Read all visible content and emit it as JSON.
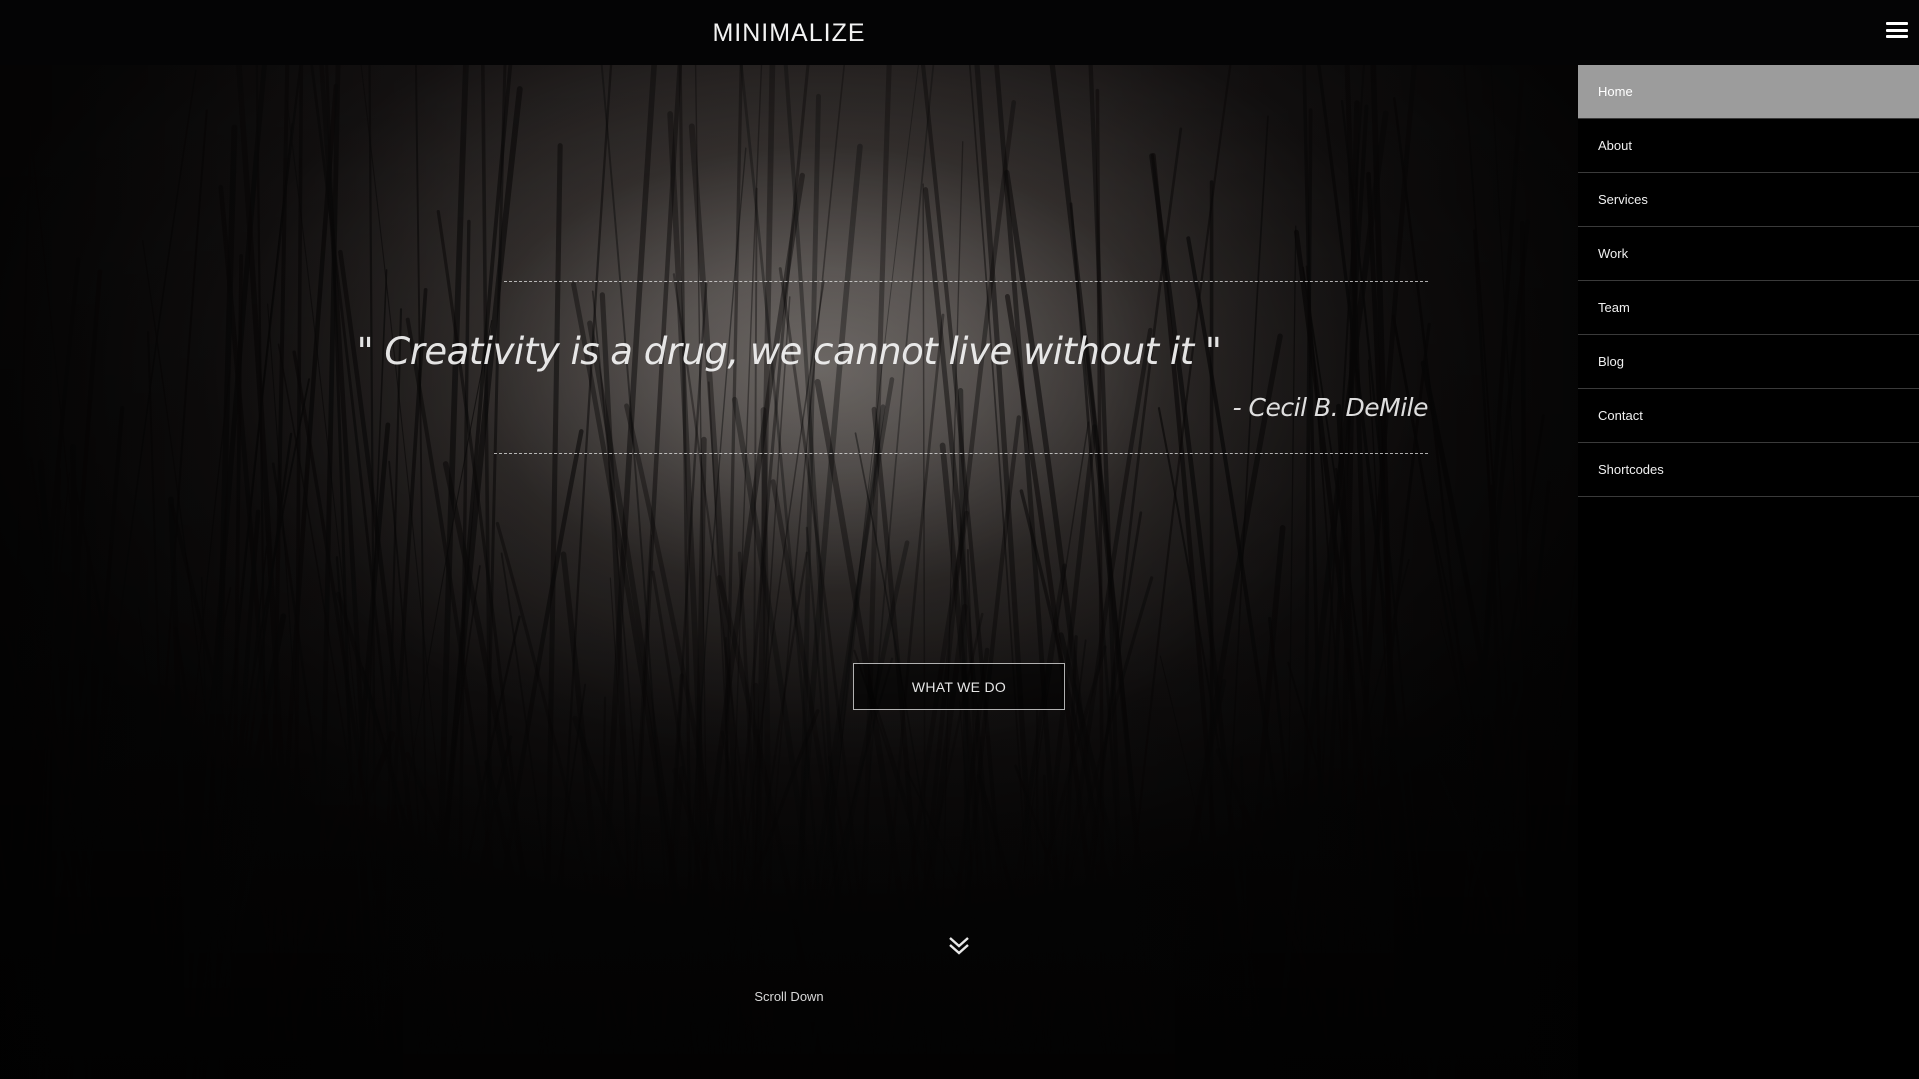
{
  "header": {
    "logo": "MINIMALIZE",
    "menu_icon": "hamburger-icon"
  },
  "hero": {
    "quote": "\" Creativity is a drug, we cannot live without it \"",
    "author": "- Cecil B. DeMile",
    "cta_label": "WHAT WE DO",
    "scroll_icon": "double-chevron-down-icon",
    "scroll_label": "Scroll Down"
  },
  "sidenav": {
    "items": [
      {
        "label": "Home",
        "active": true
      },
      {
        "label": "About",
        "active": false
      },
      {
        "label": "Services",
        "active": false
      },
      {
        "label": "Work",
        "active": false
      },
      {
        "label": "Team",
        "active": false
      },
      {
        "label": "Blog",
        "active": false
      },
      {
        "label": "Contact",
        "active": false
      },
      {
        "label": "Shortcodes",
        "active": false
      }
    ]
  },
  "colors": {
    "topbar": "#040405",
    "sidenav": "#000000",
    "nav_active": "#9c9c9c",
    "text": "#f0f0f0"
  }
}
